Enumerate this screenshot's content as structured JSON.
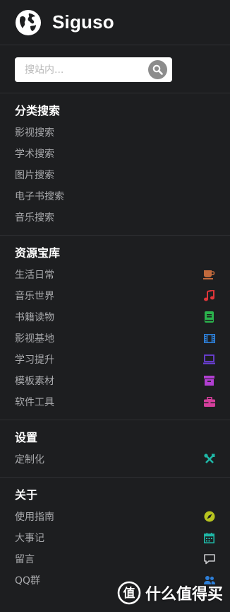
{
  "header": {
    "title": "Siguso",
    "logo_icon": "globe-icon"
  },
  "search": {
    "placeholder": "搜站内...",
    "value": "",
    "button_icon": "search-icon"
  },
  "sections": [
    {
      "title": "分类搜索",
      "items": [
        {
          "label": "影视搜索"
        },
        {
          "label": "学术搜索"
        },
        {
          "label": "图片搜索"
        },
        {
          "label": "电子书搜索"
        },
        {
          "label": "音乐搜索"
        }
      ]
    },
    {
      "title": "资源宝库",
      "items": [
        {
          "label": "生活日常",
          "icon": "coffee-cup-icon",
          "color": "#c0693c"
        },
        {
          "label": "音乐世界",
          "icon": "music-note-icon",
          "color": "#e0363a"
        },
        {
          "label": "书籍读物",
          "icon": "book-icon",
          "color": "#2bb24c"
        },
        {
          "label": "影视基地",
          "icon": "film-icon",
          "color": "#2d7fd8"
        },
        {
          "label": "学习提升",
          "icon": "laptop-icon",
          "color": "#6c3fd8"
        },
        {
          "label": "模板素材",
          "icon": "archive-box-icon",
          "color": "#b13fd1"
        },
        {
          "label": "软件工具",
          "icon": "toolbox-icon",
          "color": "#d43f9c"
        }
      ]
    },
    {
      "title": "设置",
      "items": [
        {
          "label": "定制化",
          "icon": "wrench-screwdriver-icon",
          "color": "#1fb7a6"
        }
      ]
    },
    {
      "title": "关于",
      "items": [
        {
          "label": "使用指南",
          "icon": "compass-icon",
          "color": "#b7c41f"
        },
        {
          "label": "大事记",
          "icon": "calendar-icon",
          "color": "#1fb7a6"
        },
        {
          "label": "留言",
          "icon": "comment-icon",
          "color": "#a9aaad"
        },
        {
          "label": "QQ群",
          "icon": "group-icon",
          "color": "#2d7fd8"
        }
      ]
    }
  ],
  "watermark": {
    "text": "值 什么值得买",
    "icon": "zhi-logo-icon"
  }
}
